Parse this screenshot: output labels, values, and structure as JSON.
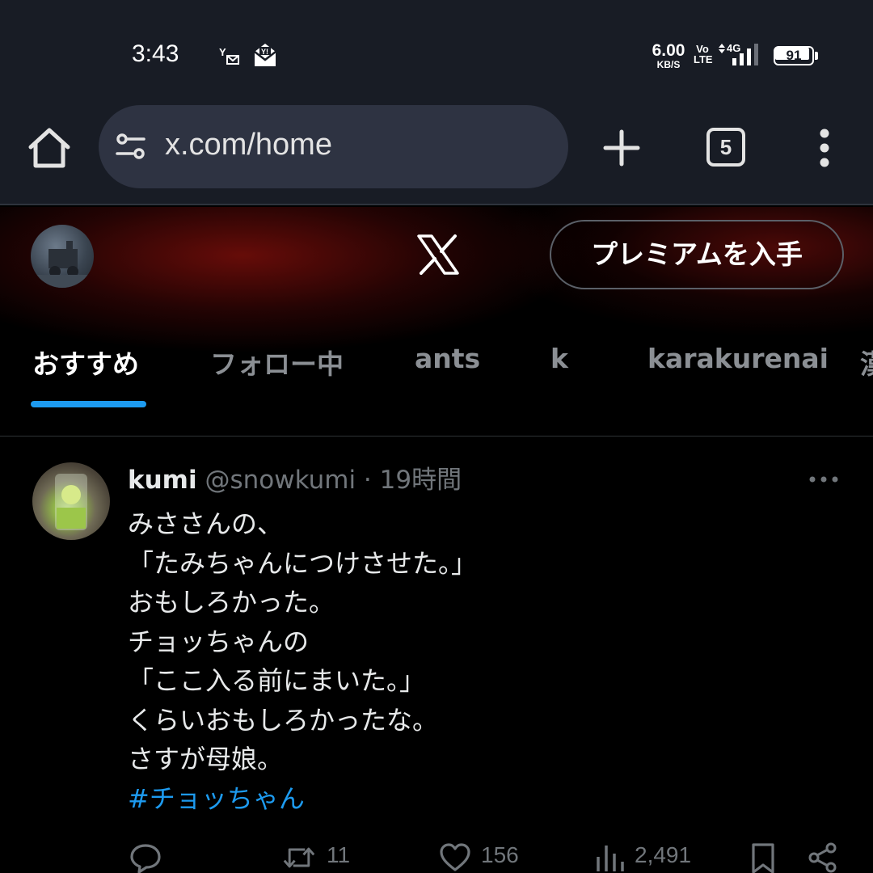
{
  "status_bar": {
    "time": "3:43",
    "net_speed_value": "6.00",
    "net_speed_unit": "KB/S",
    "volte_top": "Vo",
    "volte_bottom": "LTE",
    "network": "4G",
    "battery": "91",
    "battery_level": 0.91,
    "icons": [
      "note-icon",
      "mail-icon",
      "signal-icon",
      "battery-icon"
    ]
  },
  "browser": {
    "url": "x.com/home",
    "tab_count": "5",
    "icons": [
      "home-icon",
      "site-settings-icon",
      "plus-icon",
      "tab-switcher-icon",
      "more-vertical-icon"
    ]
  },
  "header": {
    "logo": "x-logo-icon",
    "premium_button": "プレミアムを入手"
  },
  "tabs": [
    {
      "label": "おすすめ",
      "active": true
    },
    {
      "label": "フォロー中",
      "active": false
    },
    {
      "label": "ants",
      "active": false
    },
    {
      "label": "k",
      "active": false
    },
    {
      "label": "karakurenai",
      "active": false
    },
    {
      "label": "漢",
      "active": false
    }
  ],
  "tweet": {
    "name": "kumi",
    "handle": "@snowkumi",
    "separator": "·",
    "time": "19時間",
    "lines": [
      "みささんの、",
      "「たみちゃんにつけさせた。」",
      "おもしろかった。",
      "チョッちゃんの",
      "「ここ入る前にまいた。」",
      "くらいおもしろかったな。",
      "さすが母娘。"
    ],
    "hashtag": "#チョッちゃん",
    "actions": {
      "reply_count": "",
      "retweet_count": "11",
      "like_count": "156",
      "views_count": "2,491"
    }
  },
  "colors": {
    "accent": "#1d9bf0",
    "background": "#000000",
    "browser_chrome": "#181c25",
    "secondary_text": "#71767b"
  }
}
